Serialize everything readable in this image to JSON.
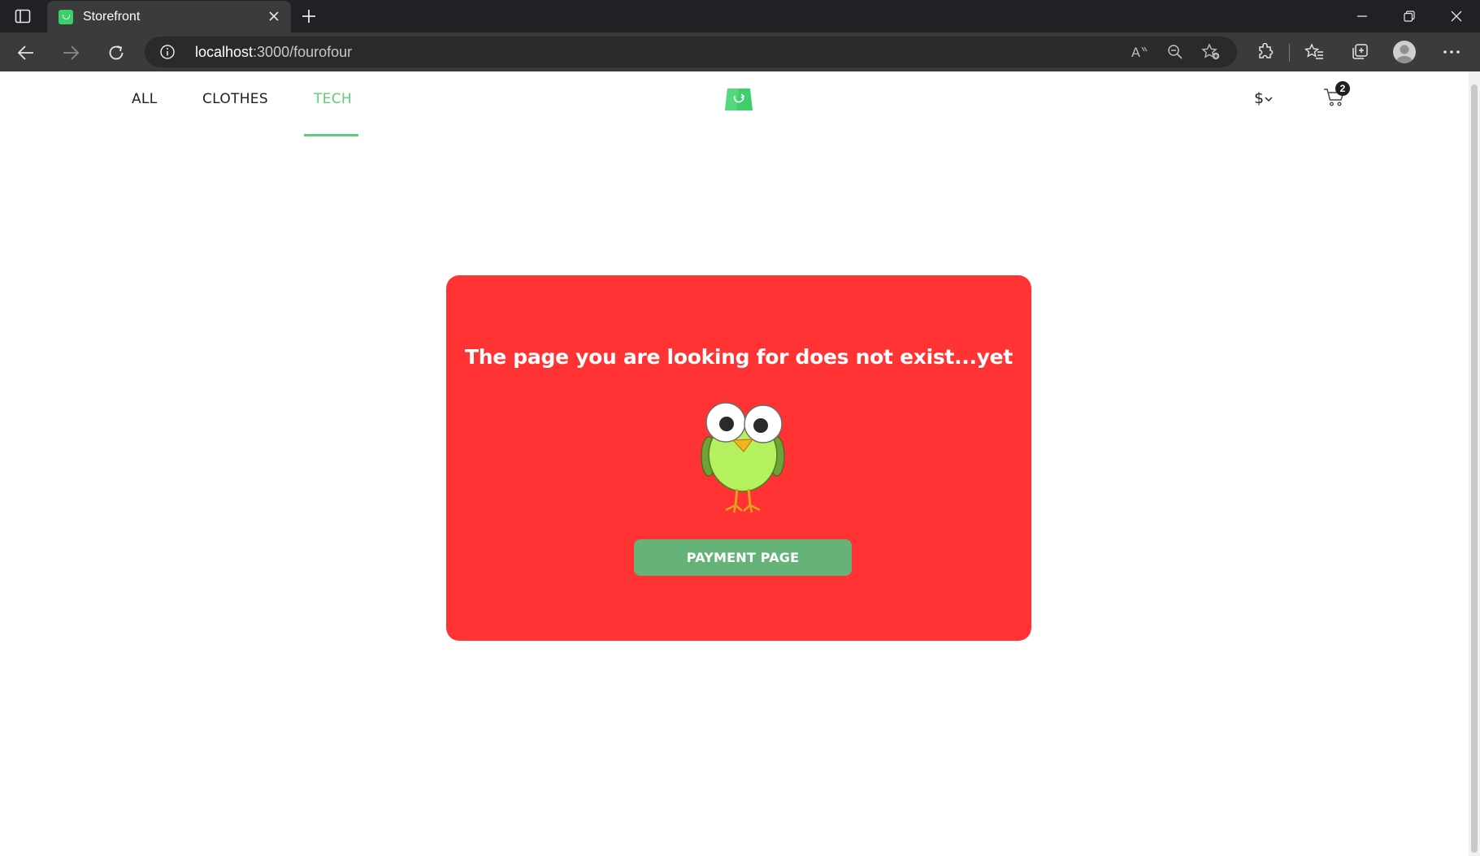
{
  "browser": {
    "tab_title": "Storefront",
    "url_host": "localhost",
    "url_path": ":3000/fourofour"
  },
  "store": {
    "nav": [
      "ALL",
      "CLOTHES",
      "TECH"
    ],
    "active_nav": "TECH",
    "currency_symbol": "$",
    "cart_count": "2",
    "accent_color": "#5ece7b"
  },
  "notfound": {
    "message": "The page you are looking for does not exist...yet",
    "button_label": "PAYMENT PAGE",
    "card_color": "#ff3333",
    "button_color": "#66b379"
  },
  "icons": {
    "browser": [
      "tab-actions-icon",
      "close-icon",
      "plus-icon",
      "minimize-icon",
      "restore-icon",
      "back-icon",
      "forward-icon",
      "refresh-icon",
      "info-icon",
      "read-aloud-icon",
      "zoom-out-icon",
      "add-favorite-icon",
      "extensions-icon",
      "favorites-icon",
      "collections-icon",
      "profile-icon",
      "more-icon"
    ],
    "store": [
      "logo-bag-icon",
      "chevron-down-icon",
      "cart-icon",
      "bird-illustration"
    ]
  }
}
